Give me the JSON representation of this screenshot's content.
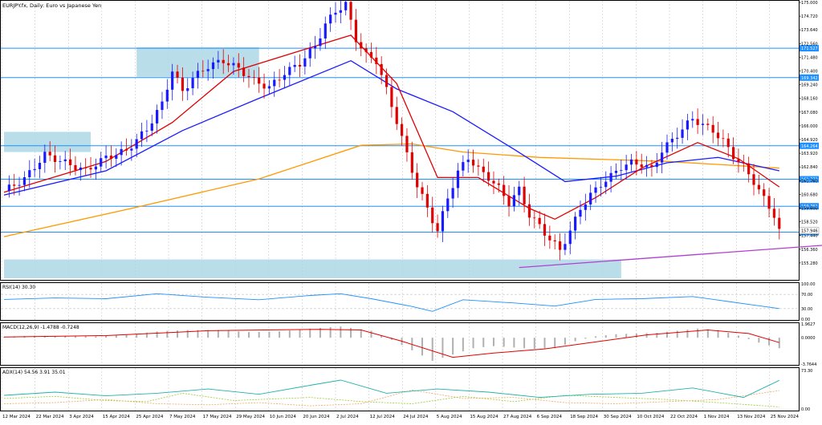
{
  "window": {
    "title": "EURJPY.fx, Daily: Euro vs Japanese Yen"
  },
  "price_axis": {
    "ticks": [
      "175.000",
      "174.720",
      "173.640",
      "172.560",
      "171.480",
      "170.400",
      "169.240",
      "168.160",
      "167.080",
      "166.000",
      "164.920",
      "163.920",
      "162.840",
      "161.760",
      "160.680",
      "159.600",
      "158.520",
      "157.440",
      "156.360",
      "155.280"
    ],
    "levels": [
      {
        "label": "171.527",
        "value": 171.527,
        "color": "#1e90ff"
      },
      {
        "label": "169.342",
        "value": 169.342,
        "color": "#1e90ff"
      },
      {
        "label": "164.264",
        "value": 164.264,
        "color": "#1e90ff"
      },
      {
        "label": "161.772",
        "value": 161.772,
        "color": "#1e90ff"
      },
      {
        "label": "159.761",
        "value": 159.761,
        "color": "#1e90ff"
      },
      {
        "label": "157.835",
        "value": 157.835,
        "color": "#1e90ff"
      }
    ],
    "current_price": "157.946",
    "range": [
      154.4,
      175.0
    ]
  },
  "dates": [
    "12 Mar 2024",
    "22 Mar 2024",
    "3 Apr 2024",
    "15 Apr 2024",
    "25 Apr 2024",
    "7 May 2024",
    "17 May 2024",
    "29 May 2024",
    "10 Jun 2024",
    "20 Jun 2024",
    "2 Jul 2024",
    "12 Jul 2024",
    "24 Jul 2024",
    "5 Aug 2024",
    "15 Aug 2024",
    "27 Aug 2024",
    "6 Sep 2024",
    "18 Sep 2024",
    "30 Sep 2024",
    "10 Oct 2024",
    "22 Oct 2024",
    "1 Nov 2024",
    "13 Nov 2024",
    "25 Nov 2024"
  ],
  "rsi": {
    "title": "RSI(14) 30.30",
    "ticks": [
      "100.00",
      "70.00",
      "30.00",
      "0.00"
    ],
    "color": "#1e90ff"
  },
  "macd": {
    "title": "MACD(12,26,9) -1.4788 -0.7248",
    "ticks": [
      "1.9627",
      "0.0000",
      "-3.7644"
    ],
    "signal_color": "#e00000",
    "histogram_color": "#b0b0b0"
  },
  "adx": {
    "title": "ADX(14) 54.56 3.91 35.01",
    "ticks": [
      "73.30",
      "0.00"
    ],
    "adx_color": "#20b2aa",
    "plus_di_color": "#9acd32",
    "minus_di_color": "#f4a460"
  },
  "chart_data": {
    "type": "candlestick",
    "title": "EURJPY.fx, Daily: Euro vs Japanese Yen",
    "colors": {
      "bull": "#1a1aff",
      "bear": "#e00000",
      "ema_fast": "#e00000",
      "ema_mid": "#1a1aff",
      "ema_slow": "#ff9900",
      "trendline": "#b040d0",
      "zone": "#add8e6"
    },
    "close_path": [
      [
        0,
        160.9
      ],
      [
        4,
        161.8
      ],
      [
        8,
        163.6
      ],
      [
        12,
        163.0
      ],
      [
        16,
        162.4
      ],
      [
        20,
        163.4
      ],
      [
        24,
        163.9
      ],
      [
        28,
        165.5
      ],
      [
        31,
        167.4
      ],
      [
        33,
        169.9
      ],
      [
        35,
        168.3
      ],
      [
        37,
        169.3
      ],
      [
        40,
        170.2
      ],
      [
        43,
        170.6
      ],
      [
        46,
        170.0
      ],
      [
        49,
        169.1
      ],
      [
        52,
        168.6
      ],
      [
        55,
        169.7
      ],
      [
        58,
        170.4
      ],
      [
        61,
        171.7
      ],
      [
        63,
        173.3
      ],
      [
        65,
        174.3
      ],
      [
        67,
        174.8
      ],
      [
        69,
        172.2
      ],
      [
        71,
        171.0
      ],
      [
        73,
        170.6
      ],
      [
        75,
        168.4
      ],
      [
        77,
        166.1
      ],
      [
        79,
        163.6
      ],
      [
        81,
        161.3
      ],
      [
        83,
        159.6
      ],
      [
        85,
        157.9
      ],
      [
        87,
        160.4
      ],
      [
        89,
        162.3
      ],
      [
        91,
        163.4
      ],
      [
        93,
        162.5
      ],
      [
        95,
        161.9
      ],
      [
        97,
        161.1
      ],
      [
        99,
        160.0
      ],
      [
        101,
        161.0
      ],
      [
        103,
        159.1
      ],
      [
        105,
        158.3
      ],
      [
        107,
        157.3
      ],
      [
        109,
        156.5
      ],
      [
        111,
        157.9
      ],
      [
        113,
        159.6
      ],
      [
        115,
        160.6
      ],
      [
        117,
        161.4
      ],
      [
        119,
        162.0
      ],
      [
        121,
        162.7
      ],
      [
        123,
        163.0
      ],
      [
        125,
        162.9
      ],
      [
        127,
        162.5
      ],
      [
        129,
        163.9
      ],
      [
        131,
        164.7
      ],
      [
        133,
        165.5
      ],
      [
        135,
        166.3
      ],
      [
        137,
        165.8
      ],
      [
        139,
        165.4
      ],
      [
        141,
        164.6
      ],
      [
        143,
        163.5
      ],
      [
        145,
        162.7
      ],
      [
        147,
        161.6
      ],
      [
        149,
        160.3
      ],
      [
        151,
        159.1
      ],
      [
        152,
        157.9
      ]
    ],
    "ema_fast_path": [
      [
        0,
        160.8
      ],
      [
        20,
        163.1
      ],
      [
        33,
        166.0
      ],
      [
        45,
        169.8
      ],
      [
        62,
        171.8
      ],
      [
        68,
        172.5
      ],
      [
        77,
        168.9
      ],
      [
        85,
        161.9
      ],
      [
        93,
        161.9
      ],
      [
        103,
        159.6
      ],
      [
        108,
        158.8
      ],
      [
        116,
        160.4
      ],
      [
        125,
        162.6
      ],
      [
        136,
        164.5
      ],
      [
        144,
        163.3
      ],
      [
        152,
        161.2
      ]
    ],
    "ema_mid_path": [
      [
        0,
        160.6
      ],
      [
        20,
        162.4
      ],
      [
        35,
        165.4
      ],
      [
        50,
        167.8
      ],
      [
        68,
        170.6
      ],
      [
        77,
        168.5
      ],
      [
        88,
        166.8
      ],
      [
        100,
        164.0
      ],
      [
        110,
        161.6
      ],
      [
        120,
        162.0
      ],
      [
        130,
        163.0
      ],
      [
        140,
        163.4
      ],
      [
        152,
        162.4
      ]
    ],
    "ema_slow_path": [
      [
        0,
        157.5
      ],
      [
        25,
        159.6
      ],
      [
        50,
        161.8
      ],
      [
        70,
        164.3
      ],
      [
        80,
        164.4
      ],
      [
        90,
        163.8
      ],
      [
        105,
        163.4
      ],
      [
        130,
        163.1
      ],
      [
        152,
        162.6
      ]
    ],
    "trendline": [
      [
        101,
        155.2
      ],
      [
        173,
        157.2
      ]
    ],
    "zones": [
      {
        "x0": 26,
        "x1": 50,
        "y0": 169.4,
        "y1": 171.6
      },
      {
        "x0": 0,
        "x1": 17,
        "y0": 163.8,
        "y1": 165.3
      },
      {
        "x0": 0,
        "x1": 121,
        "y0": 154.4,
        "y1": 155.8
      }
    ],
    "x_range": [
      0,
      175
    ],
    "y_range": [
      154.4,
      175.0
    ],
    "rsi_path": [
      [
        0,
        56
      ],
      [
        10,
        60
      ],
      [
        20,
        58
      ],
      [
        30,
        72
      ],
      [
        40,
        62
      ],
      [
        50,
        55
      ],
      [
        60,
        67
      ],
      [
        66,
        72
      ],
      [
        72,
        58
      ],
      [
        80,
        36
      ],
      [
        84,
        22
      ],
      [
        90,
        55
      ],
      [
        100,
        46
      ],
      [
        108,
        37
      ],
      [
        116,
        56
      ],
      [
        125,
        58
      ],
      [
        135,
        64
      ],
      [
        142,
        50
      ],
      [
        148,
        38
      ],
      [
        152,
        30
      ]
    ],
    "rsi_range": [
      0,
      100
    ],
    "macd_histogram": [
      [
        0,
        0.1
      ],
      [
        6,
        0.3
      ],
      [
        12,
        0.2
      ],
      [
        18,
        0.2
      ],
      [
        24,
        0.4
      ],
      [
        30,
        0.9
      ],
      [
        36,
        1.1
      ],
      [
        42,
        1.1
      ],
      [
        48,
        0.8
      ],
      [
        54,
        0.9
      ],
      [
        60,
        1.3
      ],
      [
        66,
        1.6
      ],
      [
        72,
        1.0
      ],
      [
        76,
        -0.3
      ],
      [
        80,
        -1.8
      ],
      [
        84,
        -3.3
      ],
      [
        88,
        -2.4
      ],
      [
        92,
        -1.5
      ],
      [
        96,
        -1.2
      ],
      [
        100,
        -1.4
      ],
      [
        104,
        -1.6
      ],
      [
        108,
        -1.5
      ],
      [
        112,
        -0.5
      ],
      [
        116,
        0.2
      ],
      [
        120,
        0.5
      ],
      [
        124,
        0.6
      ],
      [
        128,
        0.7
      ],
      [
        132,
        1.0
      ],
      [
        136,
        1.3
      ],
      [
        140,
        1.1
      ],
      [
        144,
        0.3
      ],
      [
        148,
        -0.7
      ],
      [
        152,
        -1.5
      ]
    ],
    "macd_signal_path": [
      [
        0,
        0.1
      ],
      [
        20,
        0.3
      ],
      [
        40,
        1.0
      ],
      [
        62,
        1.2
      ],
      [
        70,
        1.1
      ],
      [
        78,
        -0.5
      ],
      [
        88,
        -2.8
      ],
      [
        96,
        -2.2
      ],
      [
        106,
        -1.6
      ],
      [
        116,
        -0.6
      ],
      [
        126,
        0.4
      ],
      [
        138,
        1.1
      ],
      [
        146,
        0.6
      ],
      [
        152,
        -0.7
      ]
    ],
    "macd_range": [
      -3.7644,
      1.9627
    ],
    "adx_path": [
      [
        0,
        26
      ],
      [
        10,
        32
      ],
      [
        20,
        25
      ],
      [
        30,
        30
      ],
      [
        40,
        38
      ],
      [
        50,
        28
      ],
      [
        60,
        45
      ],
      [
        66,
        55
      ],
      [
        75,
        30
      ],
      [
        85,
        38
      ],
      [
        95,
        32
      ],
      [
        105,
        22
      ],
      [
        115,
        28
      ],
      [
        125,
        30
      ],
      [
        135,
        40
      ],
      [
        145,
        22
      ],
      [
        152,
        54.56
      ]
    ],
    "plus_di_path": [
      [
        0,
        20
      ],
      [
        10,
        24
      ],
      [
        20,
        16
      ],
      [
        28,
        14
      ],
      [
        35,
        30
      ],
      [
        45,
        16
      ],
      [
        60,
        22
      ],
      [
        70,
        14
      ],
      [
        80,
        10
      ],
      [
        90,
        24
      ],
      [
        100,
        14
      ],
      [
        110,
        26
      ],
      [
        120,
        22
      ],
      [
        130,
        18
      ],
      [
        140,
        12
      ],
      [
        152,
        3.91
      ]
    ],
    "minus_di_path": [
      [
        0,
        10
      ],
      [
        10,
        12
      ],
      [
        20,
        18
      ],
      [
        30,
        10
      ],
      [
        40,
        8
      ],
      [
        50,
        12
      ],
      [
        60,
        6
      ],
      [
        70,
        10
      ],
      [
        80,
        36
      ],
      [
        90,
        20
      ],
      [
        100,
        22
      ],
      [
        110,
        12
      ],
      [
        120,
        10
      ],
      [
        130,
        14
      ],
      [
        140,
        18
      ],
      [
        152,
        35.01
      ]
    ],
    "adx_range": [
      0,
      73.3
    ]
  }
}
